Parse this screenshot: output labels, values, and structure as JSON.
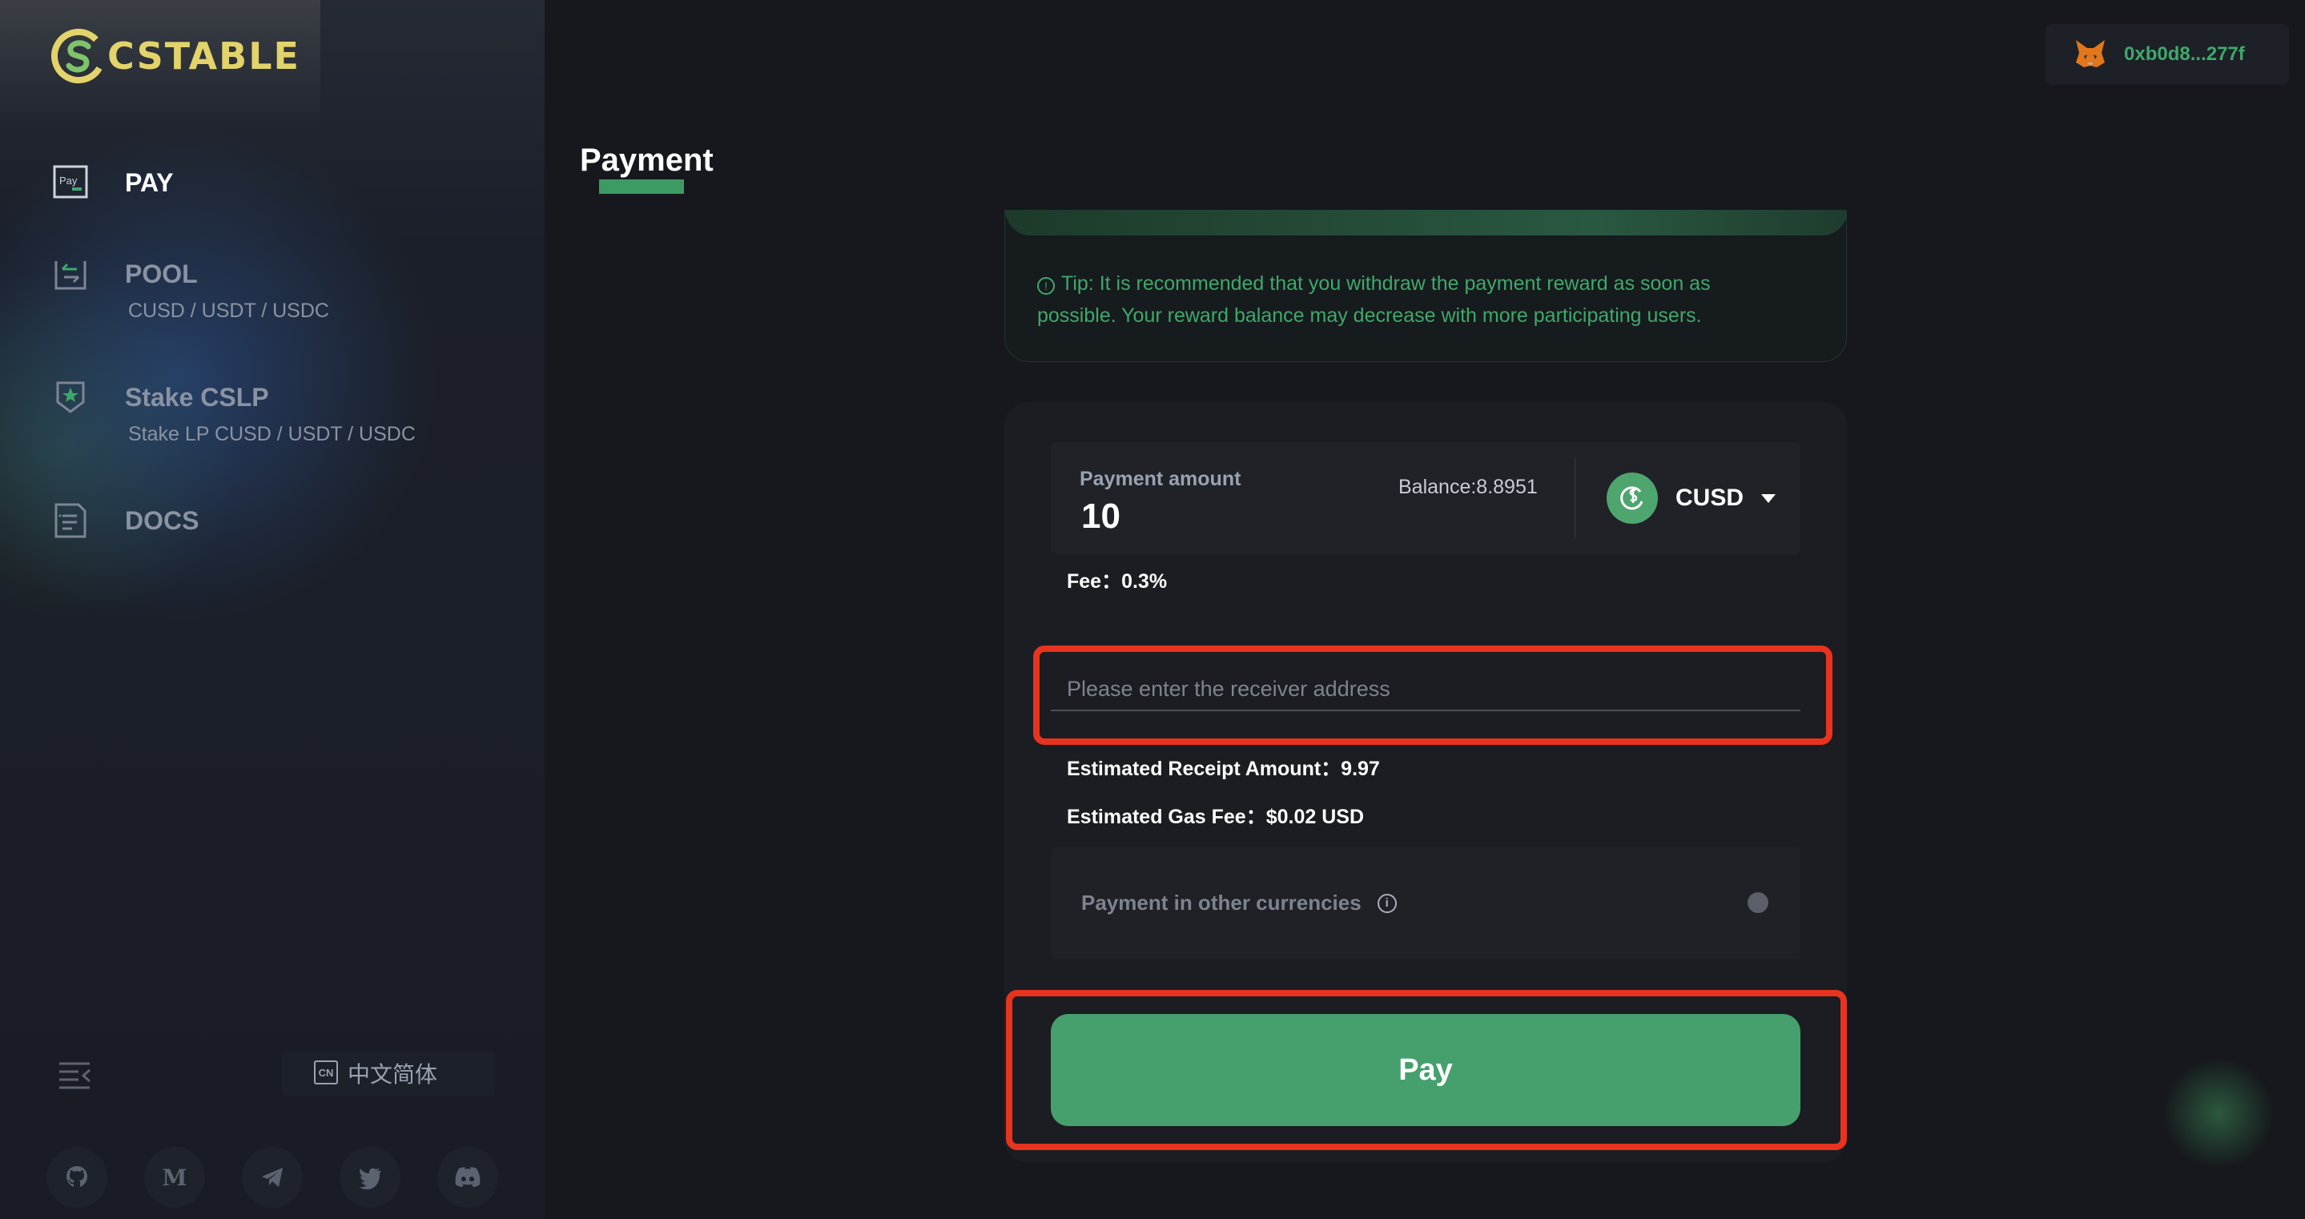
{
  "brand": {
    "name": "CSTABLE"
  },
  "sidebar": {
    "items": [
      {
        "label": "PAY",
        "icon": "pay-icon",
        "sub": ""
      },
      {
        "label": "POOL",
        "icon": "pool-icon",
        "sub": "CUSD / USDT / USDC"
      },
      {
        "label": "Stake CSLP",
        "icon": "stake-icon",
        "sub": "Stake LP CUSD / USDT / USDC"
      },
      {
        "label": "DOCS",
        "icon": "docs-icon",
        "sub": ""
      }
    ],
    "language": {
      "flag": "CN",
      "label": "中文简体"
    },
    "socials": [
      "github-icon",
      "medium-icon",
      "telegram-icon",
      "twitter-icon",
      "discord-icon"
    ]
  },
  "header": {
    "wallet_address": "0xb0d8...277f"
  },
  "main": {
    "title": "Payment",
    "tip": "Tip: It is recommended that you withdraw the payment reward as soon as possible. Your reward balance may decrease with more participating users.",
    "payment_amount_label": "Payment amount",
    "payment_amount_value": "10",
    "balance": "Balance:8.8951",
    "token": "CUSD",
    "fee": "Fee：0.3%",
    "receiver_placeholder": "Please enter the receiver address",
    "estimated_receipt": "Estimated Receipt Amount：9.97",
    "estimated_gas": "Estimated Gas Fee：$0.02 USD",
    "other_currencies": "Payment in other currencies",
    "pay_button": "Pay"
  },
  "colors": {
    "accent": "#45a06d",
    "highlight": "#e8331f",
    "logo": "#e2d36a"
  }
}
